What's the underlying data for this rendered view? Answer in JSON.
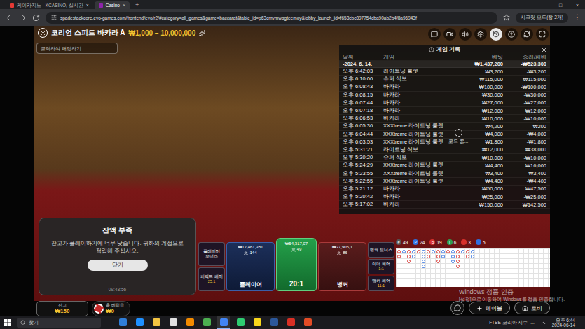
{
  "browser": {
    "tabs": [
      {
        "label": "케이카지노 - KCASINO, 실시간",
        "selected": false,
        "close": "×"
      },
      {
        "label": "Casino",
        "selected": true,
        "close": "×"
      }
    ],
    "new_tab": "+",
    "window_controls": [
      "—",
      "□",
      "×"
    ],
    "url": "spadestackcore.evo-games.com/frontend/evo/r2/#category=all_games&game=baccarat&table_id=p63cmvmwagteemoy&lobby_launch_id=f658cbc897754cba90ab2b4f8a96943f",
    "profile_button": "시크릿 모드(창 2개)",
    "menu": "⋮"
  },
  "game": {
    "title": "코리언 스피드 바카라 A",
    "limits": "₩1,000 – 10,000,000",
    "chat_placeholder": "클릭하여 채팅하기",
    "toolbar": [
      {
        "kind": "chat",
        "selected": false
      },
      {
        "kind": "video",
        "selected": false
      },
      {
        "kind": "sound",
        "selected": false
      },
      {
        "kind": "settings",
        "selected": false
      },
      {
        "kind": "history",
        "selected": true
      },
      {
        "kind": "help",
        "selected": false
      },
      {
        "kind": "refresh",
        "selected": false
      },
      {
        "kind": "fullscreen",
        "selected": false
      }
    ]
  },
  "history": {
    "title": "게임 기록",
    "columns": [
      "날짜",
      "게임",
      "베팅",
      "승리/패배"
    ],
    "date": "-2024. 6. 14.",
    "total_bet": "₩1,437,200",
    "total_result": "-₩523,300",
    "loading": "로드 중...",
    "rows": [
      {
        "time": "오후 6:42:03",
        "game": "라이트닝 룰렛",
        "bet": "₩3,200",
        "result": "-₩3,200"
      },
      {
        "time": "오후 6:10:00",
        "game": "슈퍼 식보",
        "bet": "₩115,000",
        "result": "-₩115,000"
      },
      {
        "time": "오후 6:08:43",
        "game": "바카라",
        "bet": "₩100,000",
        "result": "-₩100,000"
      },
      {
        "time": "오후 6:08:15",
        "game": "바카라",
        "bet": "₩30,000",
        "result": "-₩30,000"
      },
      {
        "time": "오후 6:07:44",
        "game": "바카라",
        "bet": "₩27,000",
        "result": "-₩27,000"
      },
      {
        "time": "오후 6:07:18",
        "game": "바카라",
        "bet": "₩12,000",
        "result": "₩12,000"
      },
      {
        "time": "오후 6:06:53",
        "game": "바카라",
        "bet": "₩10,000",
        "result": "-₩10,000"
      },
      {
        "time": "오후 6:05:36",
        "game": "XXXtreme 라이트닝 룰렛",
        "bet": "₩4,200",
        "result": "-₩200"
      },
      {
        "time": "오후 6:04:44",
        "game": "XXXtreme 라이트닝 룰렛",
        "bet": "₩4,000",
        "result": "-₩4,000"
      },
      {
        "time": "오후 6:03:53",
        "game": "XXXtreme 라이트닝 룰렛",
        "bet": "₩1,800",
        "result": "-₩1,800"
      },
      {
        "time": "오후 5:31:21",
        "game": "라이트닝 식보",
        "bet": "₩12,000",
        "result": "₩38,000"
      },
      {
        "time": "오후 5:30:20",
        "game": "슈퍼 식보",
        "bet": "₩10,000",
        "result": "-₩10,000"
      },
      {
        "time": "오후 5:24:29",
        "game": "XXXtreme 라이트닝 룰렛",
        "bet": "₩4,400",
        "result": "₩16,000"
      },
      {
        "time": "오후 5:23:55",
        "game": "XXXtreme 라이트닝 룰렛",
        "bet": "₩3,400",
        "result": "-₩3,400"
      },
      {
        "time": "오후 5:22:55",
        "game": "XXXtreme 라이트닝 룰렛",
        "bet": "₩4,400",
        "result": "-₩4,400"
      },
      {
        "time": "오후 5:21:12",
        "game": "바카라",
        "bet": "₩50,000",
        "result": "₩47,500"
      },
      {
        "time": "오후 5:20:42",
        "game": "바카라",
        "bet": "₩25,000",
        "result": "-₩25,000"
      },
      {
        "time": "오후 5:17:02",
        "game": "바카라",
        "bet": "₩150,000",
        "result": "₩142,500"
      }
    ]
  },
  "stats": [
    {
      "badge": "#",
      "value": "49",
      "color": "#555555"
    },
    {
      "badge": "P",
      "value": "24",
      "color": "#2f6fde"
    },
    {
      "badge": "B",
      "value": "19",
      "color": "#d7312c"
    },
    {
      "badge": "T",
      "value": "6",
      "color": "#2f9e4f"
    },
    {
      "badge": "",
      "value": "3",
      "color": "#d7312c"
    },
    {
      "badge": "",
      "value": "5",
      "color": "#2f6fde"
    }
  ],
  "roadmap": {
    "columns": [
      [
        "#d7312c",
        "#d7312c"
      ],
      [
        "#2f6fde"
      ],
      [
        "#d7312c",
        "#d7312c",
        "#d7312c"
      ],
      [
        "#2f6fde",
        "#2f6fde"
      ],
      [
        "#d7312c"
      ],
      [
        "#2f6fde",
        "#2f6fde",
        "#2f6fde",
        "#2f6fde"
      ],
      [
        "#d7312c",
        "#d7312c"
      ],
      [
        "#2f6fde"
      ],
      [
        "#d7312c",
        "#d7312c",
        "#d7312c"
      ],
      [
        "#2f6fde",
        "#2f6fde"
      ],
      [
        "#d7312c"
      ],
      [
        "#2f6fde",
        "#2f6fde",
        "#2f6fde"
      ],
      [
        "#d7312c",
        "#d7312c",
        "#d7312c",
        "#d7312c"
      ],
      [
        "#2f6fde"
      ],
      [
        "#d7312c",
        "#d7312c"
      ],
      [
        "#2f6fde",
        "#2f6fde"
      ]
    ]
  },
  "bet_board": {
    "left_side": [
      {
        "label": "플레이어 보너스",
        "odds": ""
      },
      {
        "label": "퍼펙트 페어",
        "odds": "25:1"
      }
    ],
    "player": {
      "label": "플레이어",
      "amount": "₩17,461,381",
      "count": "144"
    },
    "tie": {
      "odds": "20:1",
      "amount": "₩54,317,07",
      "count": "49"
    },
    "banker": {
      "label": "뱅커",
      "amount": "₩37,905,1",
      "count": "86"
    },
    "right_side": [
      {
        "label": "뱅커 보너스",
        "odds": ""
      },
      {
        "label": "이더 페어",
        "odds": "1:1"
      },
      {
        "label": "뱅커 페어",
        "odds": "11:1"
      }
    ]
  },
  "dialog": {
    "title": "잔액 부족",
    "body": "잔고가 플레이하기에 너무 낮습니다. 귀하의 계정으로 적립해 주십시오.",
    "button": "닫기",
    "time": "09:43:56"
  },
  "balance": {
    "label": "잔고",
    "value": "₩150"
  },
  "total_bet": {
    "label": "총 베팅금",
    "value": "₩0"
  },
  "watermark": {
    "title": "Windows 정품 인증",
    "body": "[설정]으로 이동하여 Windows를 정품 인증합니다."
  },
  "nav_buttons": {
    "table": "테이블",
    "lobby": "로비"
  },
  "taskbar": {
    "search": "찾기",
    "apps": [
      {
        "color": "#2f7ed8",
        "active": false
      },
      {
        "color": "#1e90ff",
        "active": false
      },
      {
        "color": "#f4c542",
        "active": false
      },
      {
        "color": "#e0e0e0",
        "active": false
      },
      {
        "color": "#f28b00",
        "active": false
      },
      {
        "color": "#4caf50",
        "active": false
      },
      {
        "color": "#4285f4",
        "active": true
      },
      {
        "color": "#2ecc71",
        "active": false
      },
      {
        "color": "#f9d71c",
        "active": false
      },
      {
        "color": "#2b579a",
        "active": false
      },
      {
        "color": "#d93025",
        "active": false
      },
      {
        "color": "#e34c26",
        "active": false
      }
    ],
    "tray_text": "FTSE 코리아 지수 -...",
    "time": "오후 6:44",
    "date": "2024-06-14"
  }
}
